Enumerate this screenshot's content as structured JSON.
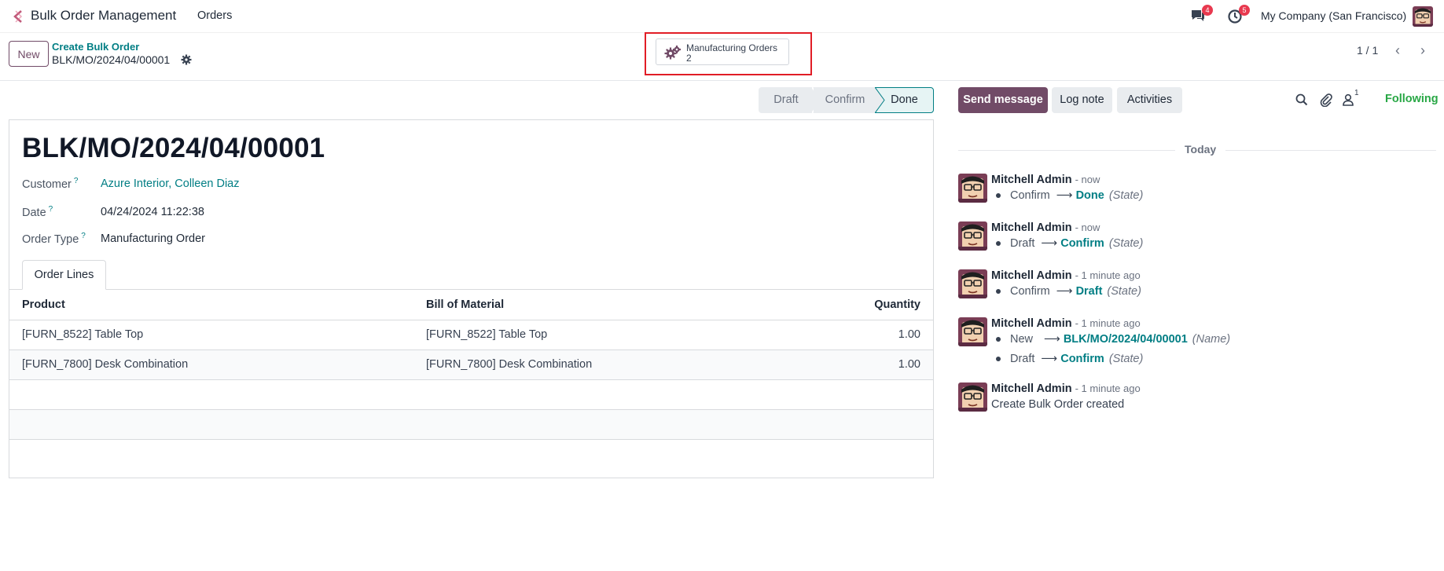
{
  "navbar": {
    "app_name": "Bulk Order Management",
    "menu_orders": "Orders",
    "messages_badge": "4",
    "activities_badge": "5",
    "company": "My Company (San Francisco)"
  },
  "control_panel": {
    "new_label": "New",
    "breadcrumb_parent": "Create Bulk Order",
    "breadcrumb_current": "BLK/MO/2024/04/00001",
    "smart_button_label": "Manufacturing Orders",
    "smart_button_count": "2",
    "pager": "1 / 1"
  },
  "status": {
    "draft": "Draft",
    "confirm": "Confirm",
    "done": "Done"
  },
  "form": {
    "title": "BLK/MO/2024/04/00001",
    "customer_label": "Customer",
    "customer_value": "Azure Interior, Colleen Diaz",
    "date_label": "Date",
    "date_value": "04/24/2024 11:22:38",
    "order_type_label": "Order Type",
    "order_type_value": "Manufacturing Order",
    "help_marker": "?",
    "tab_label": "Order Lines",
    "columns": [
      "Product",
      "Bill of Material",
      "Quantity"
    ],
    "rows": [
      {
        "product": "[FURN_8522] Table Top",
        "bom": "[FURN_8522] Table Top",
        "qty": "1.00"
      },
      {
        "product": "[FURN_7800] Desk Combination",
        "bom": "[FURN_7800] Desk Combination",
        "qty": "1.00"
      }
    ]
  },
  "chatter": {
    "send_message": "Send message",
    "log_note": "Log note",
    "activities": "Activities",
    "followers_count": "1",
    "following": "Following",
    "today": "Today",
    "messages": [
      {
        "author": "Mitchell Admin",
        "time": "- now",
        "changes": [
          {
            "old": "Confirm",
            "new": "Done",
            "field": "(State)"
          }
        ]
      },
      {
        "author": "Mitchell Admin",
        "time": "- now",
        "changes": [
          {
            "old": "Draft",
            "new": "Confirm",
            "field": "(State)"
          }
        ]
      },
      {
        "author": "Mitchell Admin",
        "time": "- 1 minute ago",
        "changes": [
          {
            "old": "Confirm",
            "new": "Draft",
            "field": "(State)"
          }
        ]
      },
      {
        "author": "Mitchell Admin",
        "time": "- 1 minute ago",
        "changes": [
          {
            "old": "New",
            "new": "BLK/MO/2024/04/00001",
            "field": "(Name)"
          },
          {
            "old": "Draft",
            "new": "Confirm",
            "field": "(State)"
          }
        ]
      },
      {
        "author": "Mitchell Admin",
        "time": "- 1 minute ago",
        "body": "Create Bulk Order created"
      }
    ]
  },
  "colors": {
    "brand": "#714b67",
    "link": "#017e84",
    "badge": "#e8394f",
    "following": "#28a745",
    "highlight": "#e11d26"
  },
  "icons": [
    "app-logo-icon",
    "chat-icon",
    "clock-icon",
    "gear-icon",
    "chevron-left-icon",
    "chevron-right-icon",
    "search-icon",
    "paperclip-icon",
    "user-icon"
  ]
}
